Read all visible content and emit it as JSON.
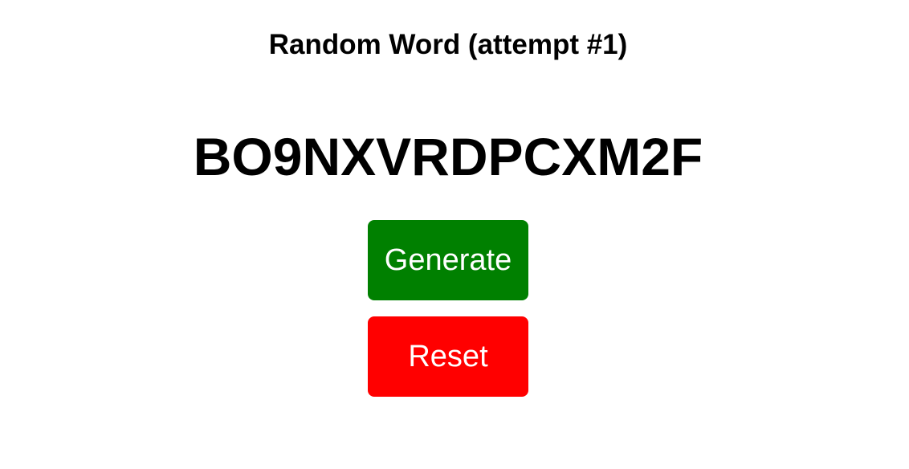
{
  "header": {
    "title": "Random Word (attempt #1)"
  },
  "main": {
    "word": "BO9NXVRDPCXM2F"
  },
  "actions": {
    "generate_label": "Generate",
    "reset_label": "Reset"
  },
  "colors": {
    "generate": "#008000",
    "reset": "#ff0000",
    "text": "#000000",
    "background": "#ffffff"
  }
}
